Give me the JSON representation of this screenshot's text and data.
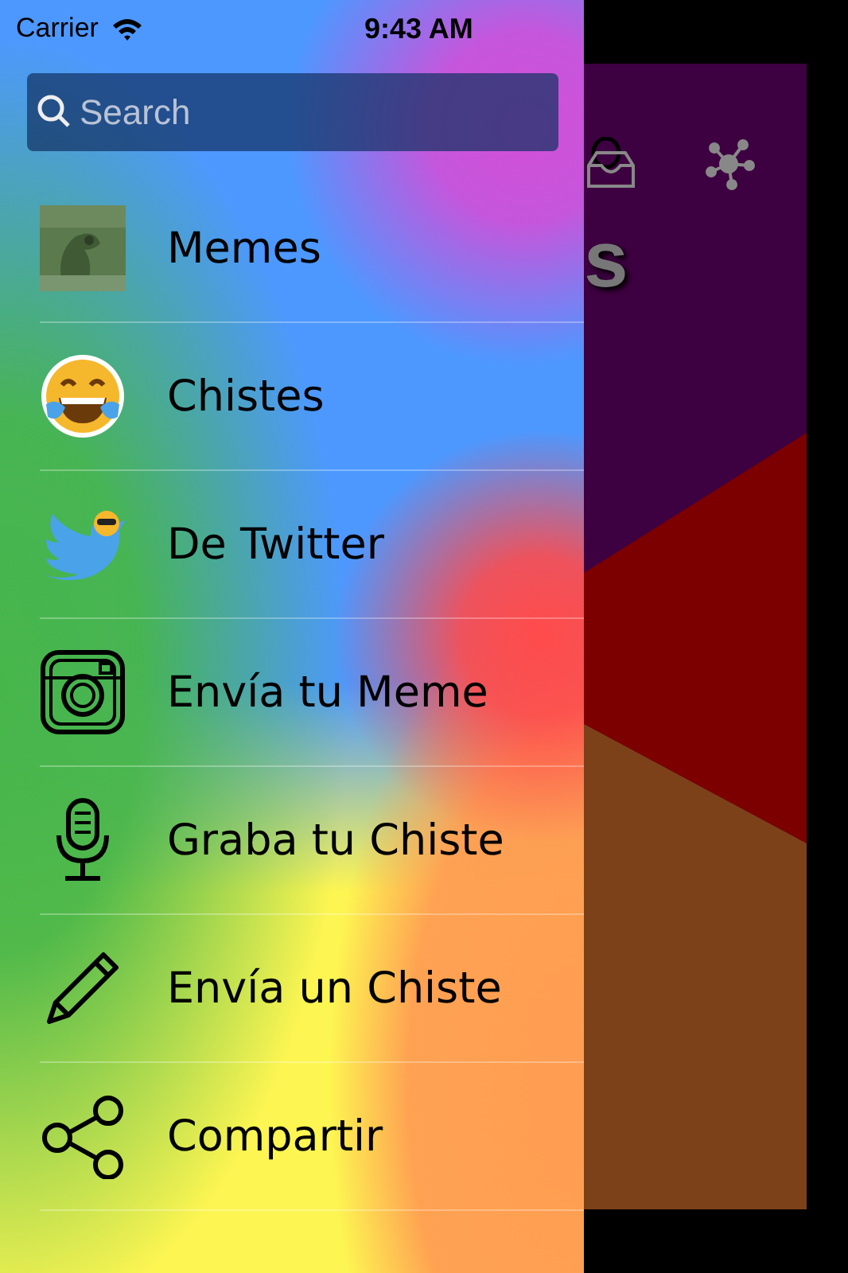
{
  "status_bar": {
    "carrier": "Carrier",
    "time": "9:43 AM"
  },
  "search": {
    "placeholder": "Search"
  },
  "menu": [
    {
      "label": "Memes",
      "kind": "picture"
    },
    {
      "label": "Chistes",
      "kind": "emoji"
    },
    {
      "label": "De Twitter",
      "kind": "bird"
    },
    {
      "label": "Envía tu Meme",
      "kind": "camera"
    },
    {
      "label": "Graba tu Chiste",
      "kind": "microphone"
    },
    {
      "label": "Envía un Chiste",
      "kind": "pencil"
    },
    {
      "label": "Compartir",
      "kind": "share"
    }
  ],
  "background_screen": {
    "title_fragment": "s"
  }
}
